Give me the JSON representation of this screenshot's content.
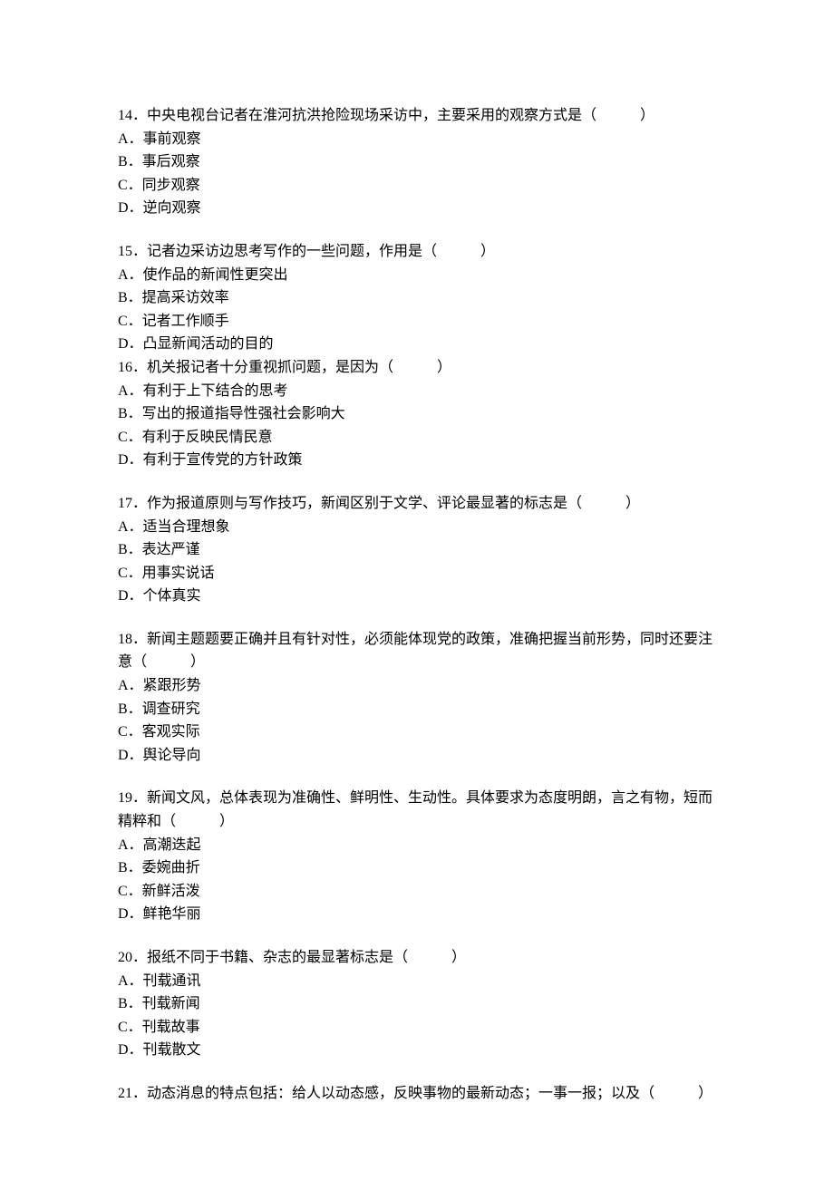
{
  "questions": [
    {
      "number": "14",
      "stem": "中央电视台记者在淮河抗洪抢险现场采访中，主要采用的观察方式是（　　　）",
      "options": [
        "A．事前观察",
        "B．事后观察",
        "C．同步观察",
        "D．逆向观察"
      ],
      "tight": false
    },
    {
      "number": "15",
      "stem": "记者边采访边思考写作的一些问题，作用是（　　　）",
      "options": [
        "A．使作品的新闻性更突出",
        "B．提高采访效率",
        "C．记者工作顺手",
        "D．凸显新闻活动的目的"
      ],
      "tight": true
    },
    {
      "number": "16",
      "stem": "机关报记者十分重视抓问题，是因为（　　　）",
      "options": [
        "A．有利于上下结合的思考",
        "B．写出的报道指导性强社会影响大",
        "C．有利于反映民情民意",
        "D．有利于宣传党的方针政策"
      ],
      "tight": false
    },
    {
      "number": "17",
      "stem": "作为报道原则与写作技巧，新闻区别于文学、评论最显著的标志是（　　　）",
      "options": [
        "A．适当合理想象",
        "B．表达严谨",
        "C．用事实说话",
        "D．个体真实"
      ],
      "tight": false
    },
    {
      "number": "18",
      "stem": "新闻主题题要正确并且有针对性，必须能体现党的政策，准确把握当前形势，同时还要注意（　　　）",
      "options": [
        "A．紧跟形势",
        "B．调查研究",
        "C．客观实际",
        "D．舆论导向"
      ],
      "tight": false
    },
    {
      "number": "19",
      "stem": "新闻文风，总体表现为准确性、鲜明性、生动性。具体要求为态度明朗，言之有物，短而精粹和（　　　）",
      "options": [
        "A．高潮迭起",
        "B．委婉曲折",
        "C．新鲜活泼",
        "D．鲜艳华丽"
      ],
      "tight": false
    },
    {
      "number": "20",
      "stem": "报纸不同于书籍、杂志的最显著标志是（　　　）",
      "options": [
        "A．刊载通讯",
        "B．刊载新闻",
        "C．刊载故事",
        "D．刊载散文"
      ],
      "tight": false
    },
    {
      "number": "21",
      "stem": "动态消息的特点包括：给人以动态感，反映事物的最新动态；一事一报；以及（　　　）",
      "options": [],
      "tight": false
    }
  ]
}
